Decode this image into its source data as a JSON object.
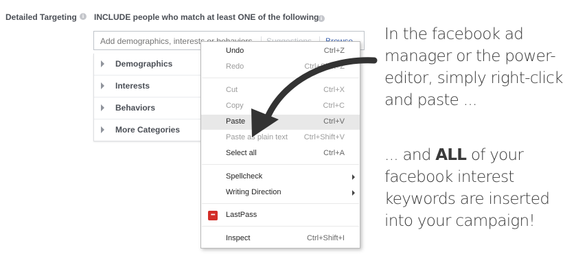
{
  "targeting": {
    "label": "Detailed Targeting",
    "include_text": "INCLUDE people who match at least ONE of the following",
    "info_icon_glyph": "i",
    "search": {
      "placeholder": "Add demographics, interests or behaviors",
      "suggestions_label": "Suggestions",
      "browse_label": "Browse"
    },
    "categories": [
      {
        "label": "Demographics"
      },
      {
        "label": "Interests"
      },
      {
        "label": "Behaviors"
      },
      {
        "label": "More Categories"
      }
    ]
  },
  "context_menu": {
    "items": [
      {
        "label": "Undo",
        "shortcut": "Ctrl+Z",
        "enabled": true
      },
      {
        "label": "Redo",
        "shortcut": "Ctrl+Shift+Z",
        "enabled": false
      },
      {
        "label": "Cut",
        "shortcut": "Ctrl+X",
        "enabled": false
      },
      {
        "label": "Copy",
        "shortcut": "Ctrl+C",
        "enabled": false
      },
      {
        "label": "Paste",
        "shortcut": "Ctrl+V",
        "enabled": true,
        "highlighted": true
      },
      {
        "label": "Paste as plain text",
        "shortcut": "Ctrl+Shift+V",
        "enabled": false
      },
      {
        "label": "Select all",
        "shortcut": "Ctrl+A",
        "enabled": true
      },
      {
        "label": "Spellcheck",
        "submenu": true,
        "enabled": true
      },
      {
        "label": "Writing Direction",
        "submenu": true,
        "enabled": true
      },
      {
        "label": "LastPass",
        "icon": "lastpass-icon",
        "icon_glyph": "•••",
        "enabled": true
      },
      {
        "label": "Inspect",
        "shortcut": "Ctrl+Shift+I",
        "enabled": true
      }
    ]
  },
  "caption": {
    "para1": [
      "In the facebook ad",
      "manager or the power-",
      "editor, simply right-click",
      "and paste ..."
    ],
    "para2_prefix": "... and ",
    "para2_bold": "ALL",
    "para2_suffix": " of your",
    "para2_lines": [
      "facebook interest",
      "keywords are inserted",
      "into your campaign!"
    ]
  },
  "colors": {
    "accent_link": "#4267b2",
    "lastpass_red": "#d32d27",
    "menu_highlight": "#e8e8e8",
    "arrow": "#333333"
  }
}
